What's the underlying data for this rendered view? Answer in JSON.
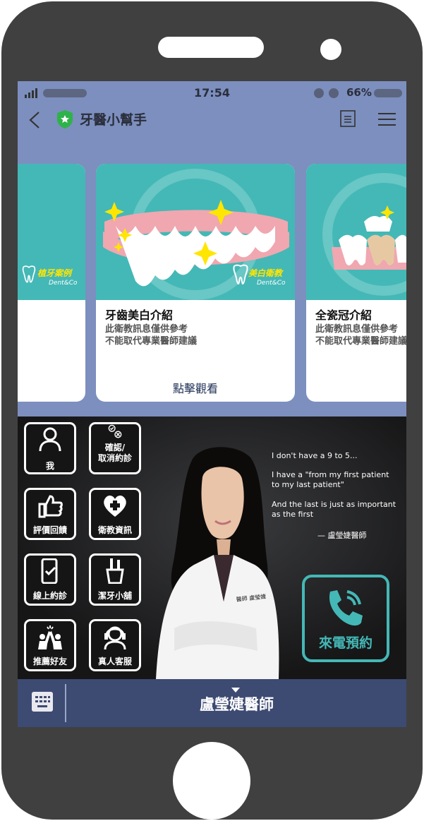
{
  "status_bar": {
    "time": "17:54",
    "battery": "66%"
  },
  "header": {
    "title": "牙醫小幫手"
  },
  "cards": [
    {
      "brand": "植牙案例",
      "brand_sub": "Dent&Co"
    },
    {
      "brand": "美白衛教",
      "brand_sub": "Dent&Co",
      "title": "牙齒美白介紹",
      "desc_line1": "此衛教訊息僅供參考",
      "desc_line2": "不能取代專業醫師建議",
      "link": "點擊觀看"
    },
    {
      "title": "全瓷冠介紹",
      "desc_line1": "此衛教訊息僅供參考",
      "desc_line2": "不能取代專業醫師建議"
    }
  ],
  "rich_menu": {
    "buttons": [
      {
        "label": "我",
        "icon": "person-icon"
      },
      {
        "label_line1": "確認/",
        "label_line2": "取消約診",
        "icon": "check-cancel-icon"
      },
      {
        "label": "評價回饋",
        "icon": "thumbs-up-icon"
      },
      {
        "label": "衛教資訊",
        "icon": "heart-plus-icon"
      },
      {
        "label": "線上約診",
        "icon": "phone-check-icon"
      },
      {
        "label": "潔牙小舖",
        "icon": "toothbrush-cup-icon"
      },
      {
        "label": "推薦好友",
        "icon": "high-five-icon"
      },
      {
        "label": "真人客服",
        "icon": "headset-agent-icon"
      }
    ],
    "quote": {
      "line1": "I don't have a 9 to 5...",
      "line2": "I have a \"from my first patient",
      "line3": "to my last patient\"",
      "line4": "And the last is just as important",
      "line5": "as the first",
      "signature": "— 盧瑩婕醫師"
    },
    "coat_badge": "醫師 盧瑩婕",
    "call_label": "來電預約"
  },
  "bottom_bar": {
    "menu_title": "盧瑩婕醫師"
  },
  "colors": {
    "teal": "#44b8b6",
    "screen_bg": "#7c8fbe",
    "bottom_bar": "#3d4a72",
    "phone_body": "#404040"
  }
}
